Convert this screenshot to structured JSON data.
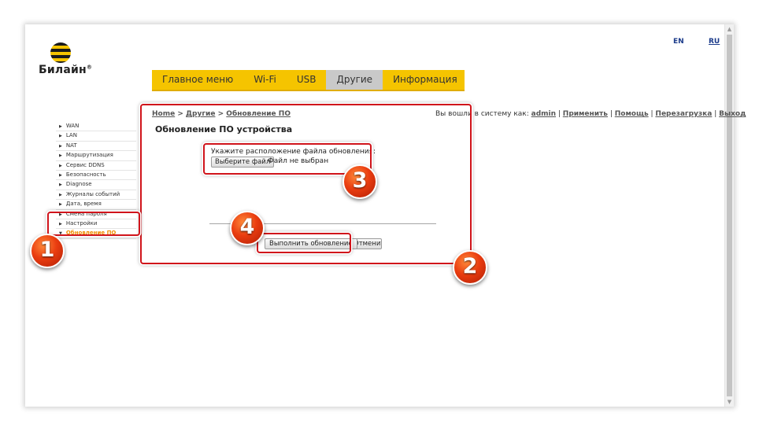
{
  "brand": {
    "name": "Билайн",
    "trademark": "®"
  },
  "languages": {
    "en": "EN",
    "ru": "RU"
  },
  "topnav": [
    "Главное меню",
    "Wi-Fi",
    "USB",
    "Другие",
    "Информация"
  ],
  "breadcrumb": {
    "home": "Home",
    "sep": ">",
    "section": "Другие",
    "page": "Обновление ПО"
  },
  "userbar": {
    "prefix": "Вы вошли в систему как:",
    "user": "admin",
    "links": [
      "Применить",
      "Помощь",
      "Перезагрузка",
      "Выход"
    ]
  },
  "sidebar": [
    "WAN",
    "LAN",
    "NAT",
    "Маршрутизация",
    "Сервис DDNS",
    "Безопасность",
    "Diagnose",
    "Журналы событий",
    "Дата, время",
    "Смена пароля",
    "Настройки",
    "Обновление ПО"
  ],
  "main": {
    "title": "Обновление ПО устройства",
    "upload_label": "Укажите расположение файла обновления:",
    "choose_file": "Выберите файл",
    "file_status": "Файл не выбран",
    "update_button": "Выполнить обновление",
    "cancel_button": "Отменить"
  },
  "annotations": [
    "1",
    "2",
    "3",
    "4"
  ]
}
